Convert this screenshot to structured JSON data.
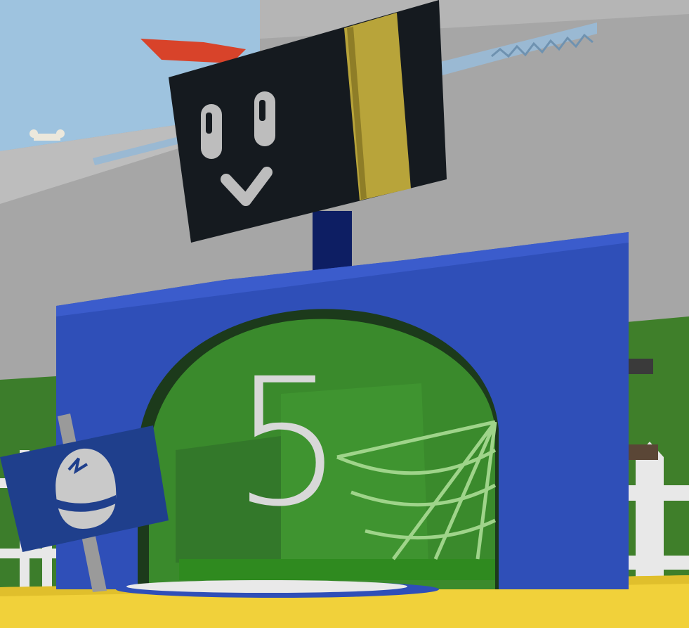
{
  "scene": {
    "gate": {
      "number": "5",
      "colors": {
        "frame": "#2f4fb8",
        "tunnel": "#3a8a2c",
        "number": "#d8d8d8",
        "web": "#9fd48a"
      }
    },
    "bee": {
      "body_color": "#151a1f",
      "stripe_color": "#b8a43a",
      "face": "happy"
    },
    "sign": {
      "icon": "cracked-egg-icon",
      "color": "#1f3f8c"
    }
  }
}
